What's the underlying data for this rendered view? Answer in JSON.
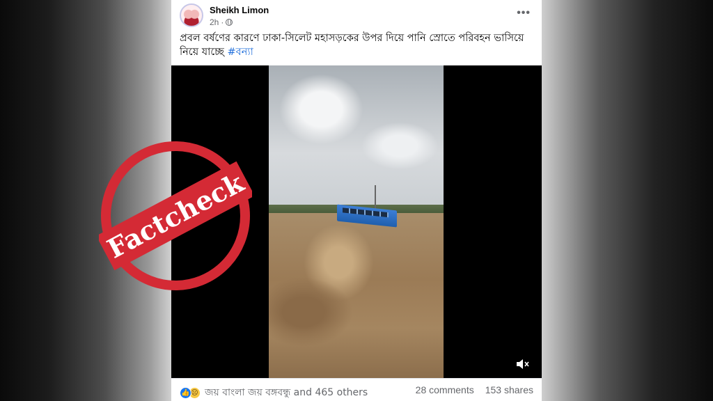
{
  "post": {
    "author": "Sheikh Limon",
    "time": "2h",
    "caption": "প্রবল বর্ষণের কারণে ঢাকা-সিলেট মহাসড়কের উপর দিয়ে পানি স্রোতে পরিবহন ভাসিয়ে নিয়ে যাচ্ছে",
    "hashtag": "#বন্যা"
  },
  "footer": {
    "reactions_text": "জয় বাংলা জয় বঙ্গবন্ধু and 465 others",
    "comments": "28 comments",
    "shares": "153 shares"
  },
  "stamp": {
    "text": "Factcheck",
    "color": "#d42a35"
  },
  "icons": [
    "globe-icon",
    "more-icon",
    "mute-icon",
    "like-icon",
    "sad-icon"
  ]
}
